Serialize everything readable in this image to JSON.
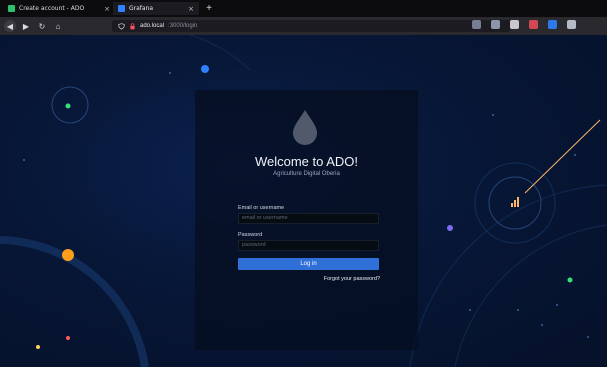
{
  "browser": {
    "tabs": [
      {
        "title": "Create account - ADO",
        "icon": "green-square-icon",
        "close": "×"
      },
      {
        "title": "Grafana",
        "icon": "blue-square-icon",
        "close": "×"
      }
    ],
    "new_tab": "+",
    "nav": {
      "back": "◀",
      "forward": "▶",
      "reload": "↻",
      "home": "⌂"
    },
    "url": {
      "host": "ado.local",
      "path": ":3000/login"
    }
  },
  "login": {
    "title": "Welcome to ADO!",
    "subtitle": "Agriculture Digital Oberia",
    "email_label": "Email or username",
    "email_placeholder": "email or username",
    "password_label": "Password",
    "password_placeholder": "password",
    "login_button": "Log in",
    "forgot_link": "Forgot your password?"
  },
  "colors": {
    "accent": "#2f6fd8",
    "background": "#071737",
    "dot_orange": "#ff9f1a",
    "dot_green": "#37e07b",
    "dot_purple": "#7d6cf2"
  }
}
